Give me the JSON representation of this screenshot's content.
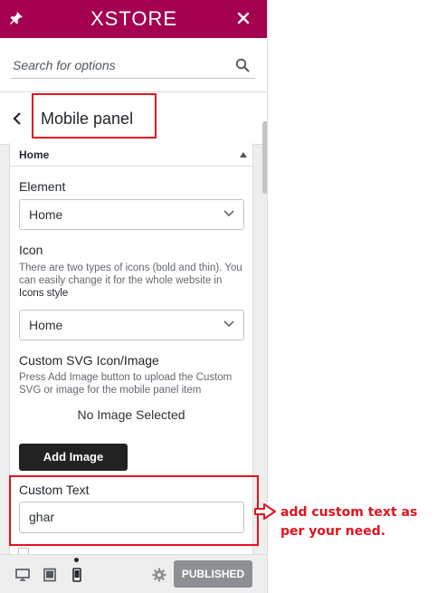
{
  "header": {
    "logo": "XSTORE",
    "icons": [
      "pin-icon",
      "close-icon"
    ]
  },
  "search": {
    "placeholder": "Search for options",
    "icon": "search-icon"
  },
  "section": {
    "title": "Mobile panel",
    "back_icon": "chevron-left-icon"
  },
  "item": {
    "name": "Home",
    "element": {
      "label": "Element",
      "value": "Home"
    },
    "icon": {
      "label": "Icon",
      "description": "There are two types of icons (bold and thin). You can easily change it for the whole website in",
      "link": "Icons style",
      "value": "Home"
    },
    "custom_svg": {
      "label": "Custom SVG Icon/Image",
      "description": "Press Add Image button to upload the Custom SVG or image for the mobile panel item",
      "status": "No Image Selected",
      "button": "Add Image"
    },
    "custom_text": {
      "label": "Custom Text",
      "value": "ghar"
    }
  },
  "footer": {
    "devices": [
      "desktop-icon",
      "tablet-icon",
      "mobile-icon"
    ],
    "active_device": "mobile",
    "publish_button": "PUBLISHED"
  },
  "annotation": {
    "text": "add custom text as per your need."
  },
  "colors": {
    "brand": "#a4004f",
    "highlight": "#e0141e",
    "button_dark": "#222222",
    "published": "#8c8f94"
  }
}
